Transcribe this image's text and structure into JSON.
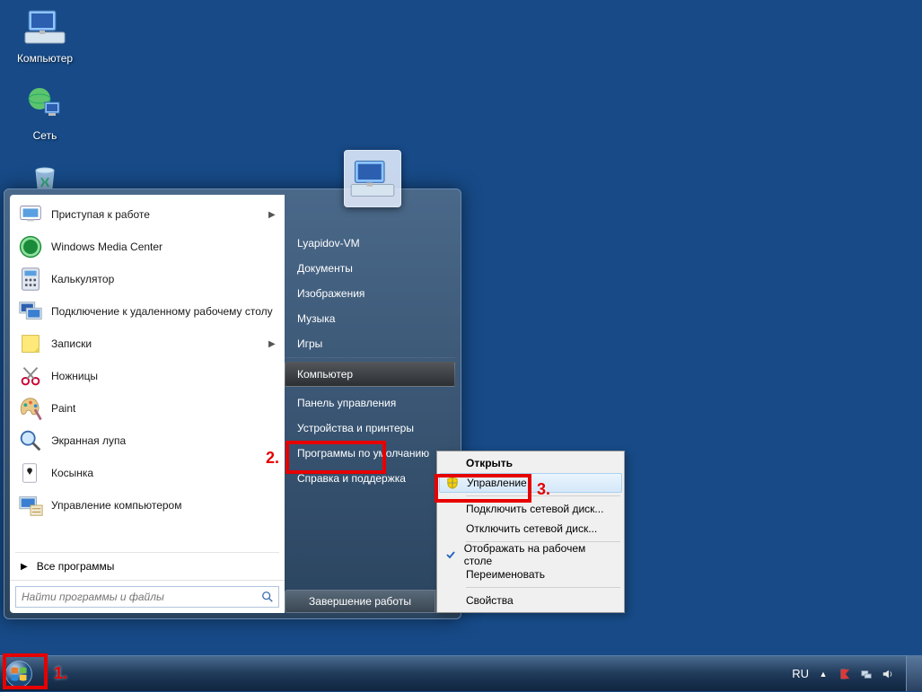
{
  "desktop_icons": [
    {
      "label": "Компьютер"
    },
    {
      "label": "Сеть"
    },
    {
      "label": "Корзина"
    }
  ],
  "start_menu": {
    "programs": [
      {
        "label": "Приступая к работе",
        "has_arrow": true
      },
      {
        "label": "Windows Media Center",
        "has_arrow": false
      },
      {
        "label": "Калькулятор",
        "has_arrow": false
      },
      {
        "label": "Подключение к удаленному рабочему столу",
        "has_arrow": false
      },
      {
        "label": "Записки",
        "has_arrow": true
      },
      {
        "label": "Ножницы",
        "has_arrow": false
      },
      {
        "label": "Paint",
        "has_arrow": false
      },
      {
        "label": "Экранная лупа",
        "has_arrow": false
      },
      {
        "label": "Косынка",
        "has_arrow": false
      },
      {
        "label": "Управление компьютером",
        "has_arrow": false
      }
    ],
    "all_programs": "Все программы",
    "search_placeholder": "Найти программы и файлы",
    "right_items": [
      "Lyapidov-VM",
      "Документы",
      "Изображения",
      "Музыка",
      "Игры",
      "Компьютер",
      "Панель управления",
      "Устройства и принтеры",
      "Программы по умолчанию",
      "Справка и поддержка"
    ],
    "shutdown_label": "Завершение работы"
  },
  "context_menu": {
    "items": [
      {
        "label": "Открыть",
        "bold": true
      },
      {
        "label": "Управление",
        "selected": true,
        "shield": true
      },
      {
        "label": "Подключить сетевой диск..."
      },
      {
        "label": "Отключить сетевой диск..."
      },
      {
        "label": "Отображать на рабочем столе",
        "checked": true
      },
      {
        "label": "Переименовать"
      },
      {
        "label": "Свойства"
      }
    ]
  },
  "taskbar": {
    "lang": "RU"
  },
  "annotations": {
    "a1": "1.",
    "a2": "2.",
    "a3": "3."
  }
}
